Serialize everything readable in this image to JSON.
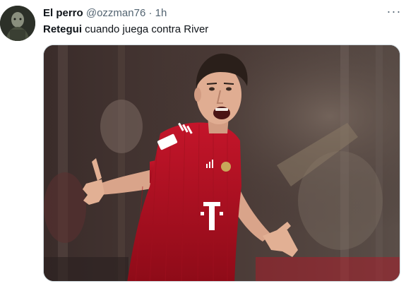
{
  "tweet": {
    "author_name": "El perro",
    "author_handle": "@ozzman76",
    "separator": "·",
    "time": "1h",
    "text_bold": "Retegui",
    "text_rest": " cuando juega contra River",
    "more_icon": "ellipsis-icon"
  },
  "media": {
    "description_icon": "photo-celebrating-player",
    "jersey_color": "#b3101e",
    "shirt_logo": "T"
  },
  "colors": {
    "text_primary": "#0f1419",
    "text_secondary": "#536471",
    "border": "#cfd9de"
  }
}
